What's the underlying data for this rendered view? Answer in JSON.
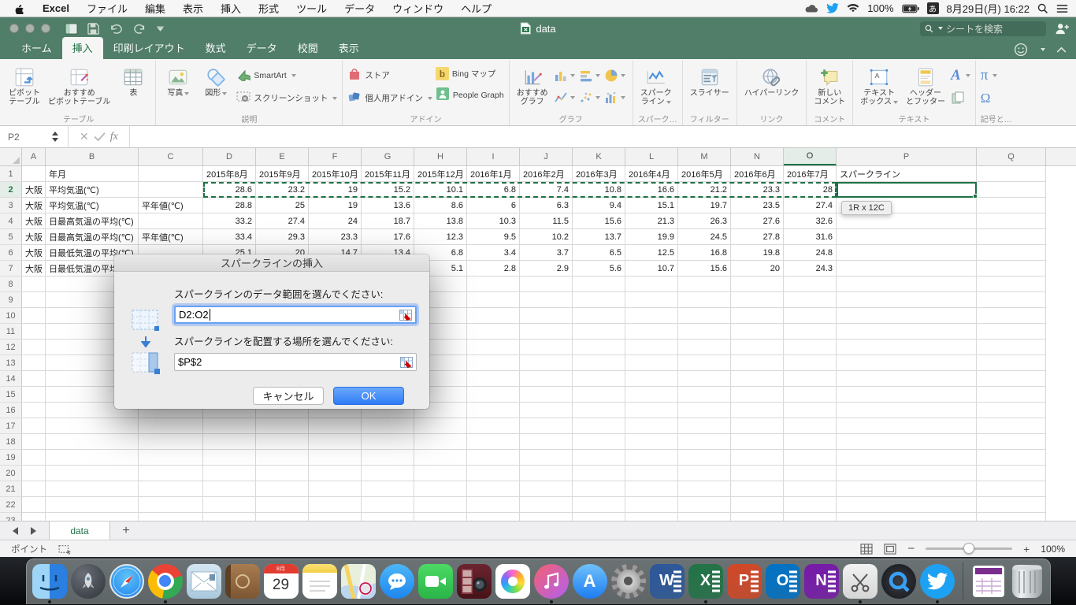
{
  "menu_bar": {
    "items": [
      "Excel",
      "ファイル",
      "編集",
      "表示",
      "挿入",
      "形式",
      "ツール",
      "データ",
      "ウィンドウ",
      "ヘルプ"
    ],
    "status": {
      "battery_pct": "100%",
      "ime": "あ",
      "datetime": "8月29日(月) 16:22"
    }
  },
  "title_bar": {
    "title": "data",
    "search_placeholder": "シートを検索"
  },
  "ribbon": {
    "tabs": [
      {
        "label": "ホーム",
        "active": false
      },
      {
        "label": "挿入",
        "active": true
      },
      {
        "label": "印刷レイアウト",
        "active": false
      },
      {
        "label": "数式",
        "active": false
      },
      {
        "label": "データ",
        "active": false
      },
      {
        "label": "校閲",
        "active": false
      },
      {
        "label": "表示",
        "active": false
      }
    ],
    "groups": [
      {
        "label": "テーブル",
        "items": [
          {
            "type": "big",
            "icon": "pivot",
            "lines": [
              "ピボット",
              "テーブル"
            ]
          },
          {
            "type": "big",
            "icon": "recpivot",
            "lines": [
              "おすすめ",
              "ピボットテーブル"
            ]
          },
          {
            "type": "big",
            "icon": "table",
            "lines": [
              "表"
            ]
          }
        ]
      },
      {
        "label": "説明",
        "items": [
          {
            "type": "big",
            "icon": "photo",
            "lines": [
              "写真"
            ],
            "caret": true
          },
          {
            "type": "big",
            "icon": "shapes",
            "lines": [
              "図形"
            ],
            "caret": true
          },
          {
            "type": "col",
            "rows": [
              {
                "icon": "smartart",
                "label": "SmartArt",
                "caret": true
              },
              {
                "icon": "screenshot",
                "label": "スクリーンショット",
                "caret": true
              }
            ]
          }
        ]
      },
      {
        "label": "アドイン",
        "items": [
          {
            "type": "col",
            "rows": [
              {
                "icon": "store",
                "label": "ストア"
              },
              {
                "icon": "myaddins",
                "label": "個人用アドイン",
                "caret": true
              }
            ]
          },
          {
            "type": "col",
            "rows": [
              {
                "icon": "bingmap",
                "label": "Bing マップ"
              },
              {
                "icon": "peoplegraph",
                "label": "People Graph"
              }
            ]
          }
        ]
      },
      {
        "label": "グラフ",
        "items": [
          {
            "type": "big",
            "icon": "recchart",
            "lines": [
              "おすすめ",
              "グラフ"
            ]
          },
          {
            "type": "grid",
            "icons": [
              "chartcol",
              "chartbar",
              "chartpie",
              "chartline",
              "chartscatter",
              "chartother"
            ]
          }
        ]
      },
      {
        "label": "スパーク…",
        "items": [
          {
            "type": "big",
            "icon": "sparkline",
            "lines": [
              "スパーク",
              "ライン"
            ],
            "caret": true
          }
        ]
      },
      {
        "label": "フィルター",
        "items": [
          {
            "type": "big",
            "icon": "slicer",
            "lines": [
              "スライサー"
            ]
          }
        ]
      },
      {
        "label": "リンク",
        "items": [
          {
            "type": "big",
            "icon": "hyperlink",
            "lines": [
              "ハイパーリンク"
            ]
          }
        ]
      },
      {
        "label": "コメント",
        "items": [
          {
            "type": "big",
            "icon": "comment",
            "lines": [
              "新しい",
              "コメント"
            ]
          }
        ]
      },
      {
        "label": "テキスト",
        "items": [
          {
            "type": "big",
            "icon": "textbox",
            "lines": [
              "テキスト",
              "ボックス"
            ],
            "caret": true
          },
          {
            "type": "big",
            "icon": "headerfooter",
            "lines": [
              "ヘッダー",
              "とフッター"
            ]
          },
          {
            "type": "col",
            "rows": [
              {
                "icon": "wordart",
                "label": "",
                "caret": true
              },
              {
                "icon": "pages",
                "label": ""
              }
            ]
          }
        ]
      },
      {
        "label": "記号と…",
        "items": [
          {
            "type": "col",
            "rows": [
              {
                "icon": "pi",
                "label": "",
                "caret": true
              },
              {
                "icon": "omega",
                "label": ""
              }
            ]
          }
        ]
      }
    ],
    "symbols": {
      "pi": "π",
      "omega": "Ω",
      "bing_b": "b",
      "wordart_a": "A"
    }
  },
  "formula_bar": {
    "name_box": "P2",
    "fx": "fx"
  },
  "sheet": {
    "column_letters": [
      "A",
      "B",
      "C",
      "D",
      "E",
      "F",
      "G",
      "H",
      "I",
      "J",
      "K",
      "L",
      "M",
      "N",
      "O",
      "P",
      "Q",
      ""
    ],
    "selected_column": "P",
    "selected_row": "2",
    "visible_row_count": 23,
    "tooltip": "1R x 12C"
  },
  "table": {
    "header_b": "年月",
    "sparkline_header": "スパークライン",
    "months": [
      "2015年8月",
      "2015年9月",
      "2015年10月",
      "2015年11月",
      "2015年12月",
      "2016年1月",
      "2016年2月",
      "2016年3月",
      "2016年4月",
      "2016年5月",
      "2016年6月",
      "2016年7月"
    ],
    "rows": [
      {
        "city": "大阪",
        "label": "平均気温(℃)",
        "sub": "",
        "values": [
          "28.6",
          "23.2",
          "19",
          "15.2",
          "10.1",
          "6.8",
          "7.4",
          "10.8",
          "16.6",
          "21.2",
          "23.3",
          "28"
        ]
      },
      {
        "city": "大阪",
        "label": "平均気温(℃)",
        "sub": "平年値(℃)",
        "values": [
          "28.8",
          "25",
          "19",
          "13.6",
          "8.6",
          "6",
          "6.3",
          "9.4",
          "15.1",
          "19.7",
          "23.5",
          "27.4"
        ]
      },
      {
        "city": "大阪",
        "label": "日最高気温の平均(℃)",
        "sub": "",
        "values": [
          "33.2",
          "27.4",
          "24",
          "18.7",
          "13.8",
          "10.3",
          "11.5",
          "15.6",
          "21.3",
          "26.3",
          "27.6",
          "32.6"
        ]
      },
      {
        "city": "大阪",
        "label": "日最高気温の平均(℃)",
        "sub": "平年値(℃)",
        "values": [
          "33.4",
          "29.3",
          "23.3",
          "17.6",
          "12.3",
          "9.5",
          "10.2",
          "13.7",
          "19.9",
          "24.5",
          "27.8",
          "31.6"
        ]
      },
      {
        "city": "大阪",
        "label": "日最低気温の平均(℃)",
        "sub": "",
        "values": [
          "25.1",
          "20",
          "14.7",
          "13.4",
          "6.8",
          "3.4",
          "3.7",
          "6.5",
          "12.5",
          "16.8",
          "19.8",
          "24.8"
        ]
      },
      {
        "city": "大阪",
        "label": "日最低気温の平均(℃)",
        "sub": "",
        "values": [
          "",
          "",
          "",
          "",
          "5.1",
          "2.8",
          "2.9",
          "5.6",
          "10.7",
          "15.6",
          "20",
          "24.3"
        ]
      }
    ]
  },
  "dialog": {
    "title": "スパークラインの挿入",
    "data_range_label": "スパークラインのデータ範囲を選んでください:",
    "data_range_value": "D2:O2",
    "location_label": "スパークラインを配置する場所を選んでください:",
    "location_value": "$P$2",
    "cancel_label": "キャンセル",
    "ok_label": "OK"
  },
  "sheet_tabs": {
    "active": "data",
    "add_label": "+"
  },
  "status_bar": {
    "mode": "ポイント",
    "zoom": "100%"
  },
  "dock": {
    "items": [
      {
        "name": "finder",
        "running": true
      },
      {
        "name": "launchpad",
        "running": false
      },
      {
        "name": "safari",
        "running": false
      },
      {
        "name": "chrome",
        "running": true
      },
      {
        "name": "mail",
        "running": false
      },
      {
        "name": "contacts",
        "running": false
      },
      {
        "name": "calendar",
        "running": false,
        "month": "8月",
        "day": "29"
      },
      {
        "name": "notes",
        "running": false
      },
      {
        "name": "maps",
        "running": false
      },
      {
        "name": "messages",
        "running": false
      },
      {
        "name": "facetime",
        "running": false
      },
      {
        "name": "photobooth",
        "running": false
      },
      {
        "name": "photos",
        "running": false
      },
      {
        "name": "itunes",
        "running": true
      },
      {
        "name": "appstore",
        "running": false,
        "letter": "A"
      },
      {
        "name": "sysprefs",
        "running": false
      },
      {
        "name": "word",
        "running": false,
        "letter": "W",
        "color": "#2b579a"
      },
      {
        "name": "excel",
        "running": true,
        "letter": "X",
        "color": "#217346"
      },
      {
        "name": "powerpoint",
        "running": false,
        "letter": "P",
        "color": "#d24726"
      },
      {
        "name": "outlook",
        "running": false,
        "letter": "O",
        "color": "#0072c6"
      },
      {
        "name": "onenote",
        "running": false,
        "letter": "N",
        "color": "#7719aa"
      },
      {
        "name": "grab",
        "running": true
      },
      {
        "name": "quicktime",
        "running": false,
        "letter": "Q"
      },
      {
        "name": "twitter",
        "running": true
      },
      {
        "name": "divider"
      },
      {
        "name": "document",
        "running": false
      },
      {
        "name": "trash",
        "running": false
      }
    ]
  },
  "colors": {
    "excel_green": "#217346",
    "titlebar_green": "#507e69",
    "ok_blue": "#2e7bf6",
    "ants_green": "#1e7145"
  }
}
